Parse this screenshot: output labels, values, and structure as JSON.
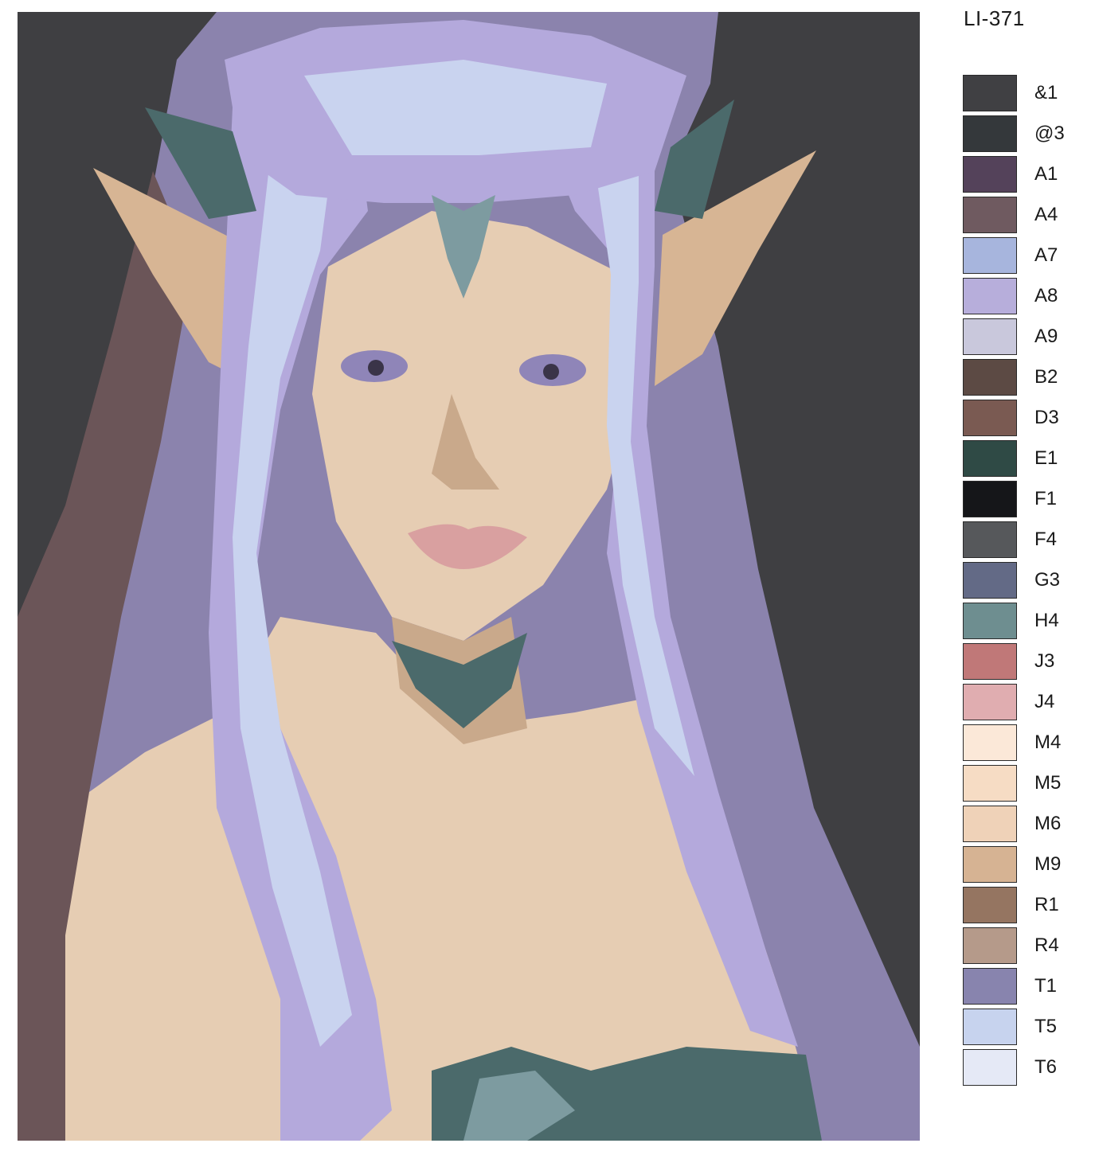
{
  "product_code": "LI-371",
  "artwork": {
    "subject_icon": "elf-portrait-illustration",
    "colors": {
      "background": "#3f3f42",
      "hair_main": "#b4a9dc",
      "hair_light": "#c9d3ef",
      "hair_shadow": "#8b83ad",
      "skin": "#e6cdb3",
      "skin_shadow": "#c9a98b",
      "ear": "#d7b594",
      "eyes": "#8f85b8",
      "lips": "#d9a0a0",
      "garment": "#4b6a6b",
      "garment_light": "#7d9ba0",
      "dark_shadow": "#6b5558"
    }
  },
  "palette": [
    {
      "label": "&1",
      "color": "#404043"
    },
    {
      "label": "@3",
      "color": "#34383b"
    },
    {
      "label": "A1",
      "color": "#54425a"
    },
    {
      "label": "A4",
      "color": "#6f5a60"
    },
    {
      "label": "A7",
      "color": "#a7b5dd"
    },
    {
      "label": "A8",
      "color": "#b7aedb"
    },
    {
      "label": "A9",
      "color": "#c9c8dc"
    },
    {
      "label": "B2",
      "color": "#5c4a44"
    },
    {
      "label": "D3",
      "color": "#7a5a52"
    },
    {
      "label": "E1",
      "color": "#2f4a45"
    },
    {
      "label": "F1",
      "color": "#151619"
    },
    {
      "label": "F4",
      "color": "#56585b"
    },
    {
      "label": "G3",
      "color": "#636a86"
    },
    {
      "label": "H4",
      "color": "#6e8e90"
    },
    {
      "label": "J3",
      "color": "#c07878"
    },
    {
      "label": "J4",
      "color": "#e0adb0"
    },
    {
      "label": "M4",
      "color": "#fbe8d8"
    },
    {
      "label": "M5",
      "color": "#f6dcc4"
    },
    {
      "label": "M6",
      "color": "#efd2b8"
    },
    {
      "label": "M9",
      "color": "#d6b393"
    },
    {
      "label": "R1",
      "color": "#957561"
    },
    {
      "label": "R4",
      "color": "#b59a8a"
    },
    {
      "label": "T1",
      "color": "#8884ae"
    },
    {
      "label": "T5",
      "color": "#c7d3ee"
    },
    {
      "label": "T6",
      "color": "#e5e9f6"
    }
  ]
}
